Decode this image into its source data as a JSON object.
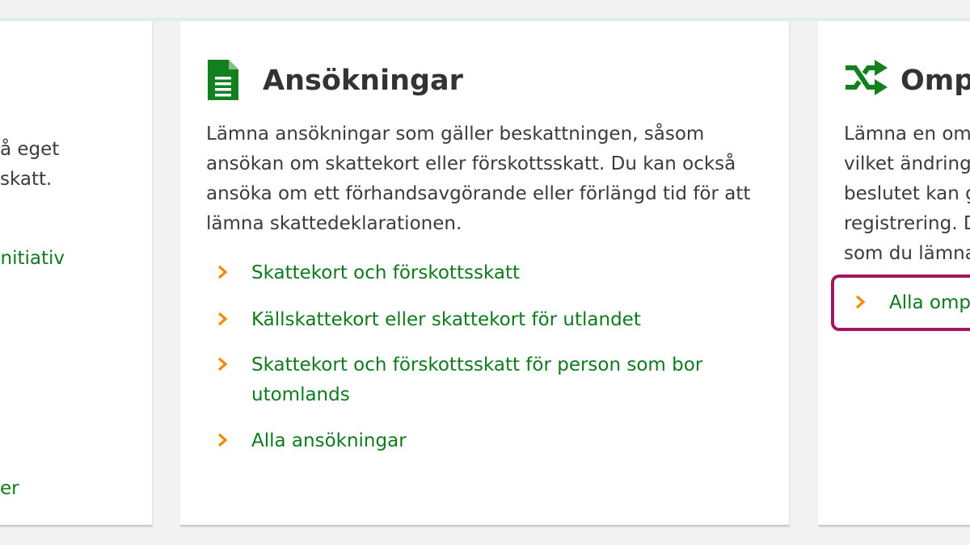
{
  "left_card": {
    "desc_lines": [
      "å eget",
      "skatt."
    ],
    "link_fragment_1": "nitiativ",
    "link_fragment_2": "er"
  },
  "middle_card": {
    "icon": "document-icon",
    "title": "Ansökningar",
    "desc_lines": [
      "Lämna ansökningar som gäller beskattningen, såsom",
      "ansökan om skattekort eller förskottsskatt. Du kan också",
      "ansöka om ett förhandsavgörande eller förlängd tid för att",
      "lämna skattedeklarationen."
    ],
    "links": [
      {
        "lines": [
          "Skattekort och förskottsskatt"
        ]
      },
      {
        "lines": [
          "Källskattekort eller skattekort för utlandet"
        ]
      },
      {
        "lines": [
          "Skattekort och förskottsskatt för person som bor",
          "utomlands"
        ]
      },
      {
        "lines": [
          "Alla ansökningar"
        ]
      }
    ]
  },
  "right_card": {
    "icon": "shuffle-icon",
    "title": "Omp",
    "desc_lines": [
      "Lämna en om",
      "vilket ändring",
      "beslutet kan g",
      "registrering. D",
      "som du lämna"
    ],
    "link": "Alla omp"
  },
  "colors": {
    "link_green": "#0e7a1e",
    "chevron_orange": "#f08c00",
    "icon_green": "#12801e",
    "focus_ring": "#a2175f"
  }
}
